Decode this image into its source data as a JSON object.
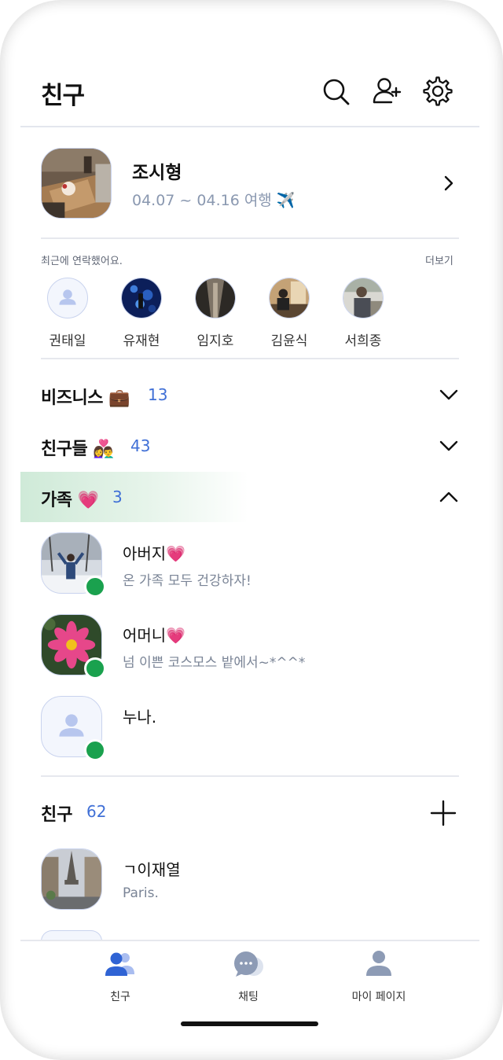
{
  "header": {
    "title": "친구"
  },
  "profile": {
    "name": "조시형",
    "status": "04.07 ~ 04.16 여행 ✈️"
  },
  "recent": {
    "label": "최근에 연락했어요.",
    "more": "더보기",
    "people": [
      {
        "name": "권태일"
      },
      {
        "name": "유재현"
      },
      {
        "name": "임지호"
      },
      {
        "name": "김윤식"
      },
      {
        "name": "서희종"
      }
    ]
  },
  "groups": [
    {
      "title": "비즈니스 💼",
      "count": "13"
    },
    {
      "title": "친구들 👩‍❤️‍👨",
      "count": "43"
    },
    {
      "title": "가족 💗",
      "count": "3"
    }
  ],
  "family": [
    {
      "name": "아버지💗",
      "message": "온 가족 모두 건강하자!"
    },
    {
      "name": "어머니💗",
      "message": "넘 이쁜 코스모스 밭에서~*^^*"
    },
    {
      "name": "누나.",
      "message": ""
    }
  ],
  "friends_section": {
    "title": "친구",
    "count": "62",
    "items": [
      {
        "name": "ㄱ이재열",
        "message": "Paris."
      }
    ]
  },
  "nav": {
    "items": [
      {
        "label": "친구"
      },
      {
        "label": "채팅"
      },
      {
        "label": "마이 페이지"
      }
    ]
  },
  "colors": {
    "accent": "#3f6fd6",
    "online": "#1aa14e",
    "icon_inactive": "#8d9bb5"
  }
}
